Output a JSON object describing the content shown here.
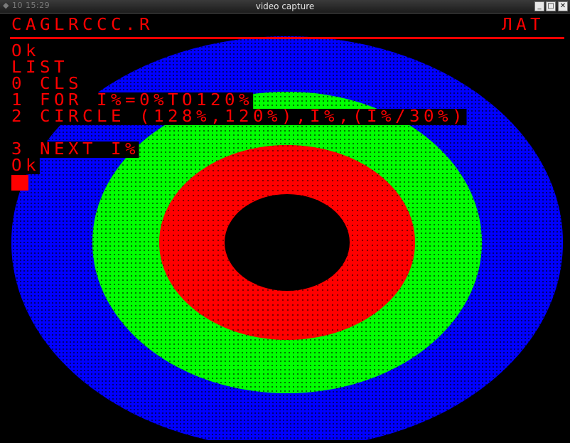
{
  "window": {
    "title": "video capture",
    "clock": "◆ 10 15:29",
    "buttons": {
      "minimize": "_",
      "maximize": "□",
      "close": "✕"
    }
  },
  "screen": {
    "program_name": "CAGLRCCC.R",
    "keyboard_mode": "ЛАТ",
    "lines": [
      "Ok",
      "LIST",
      "0 CLS",
      "1 FOR I%=0%TO120%",
      "2 CIRCLE (128%,120%),I%,(I%/30%)",
      "3 NEXT I%",
      "Ok"
    ],
    "colors": {
      "text": "#ff0000",
      "background": "#000000",
      "ring_outer": "#0000ff",
      "ring_middle": "#00ff00",
      "ring_inner": "#ff0000"
    }
  }
}
